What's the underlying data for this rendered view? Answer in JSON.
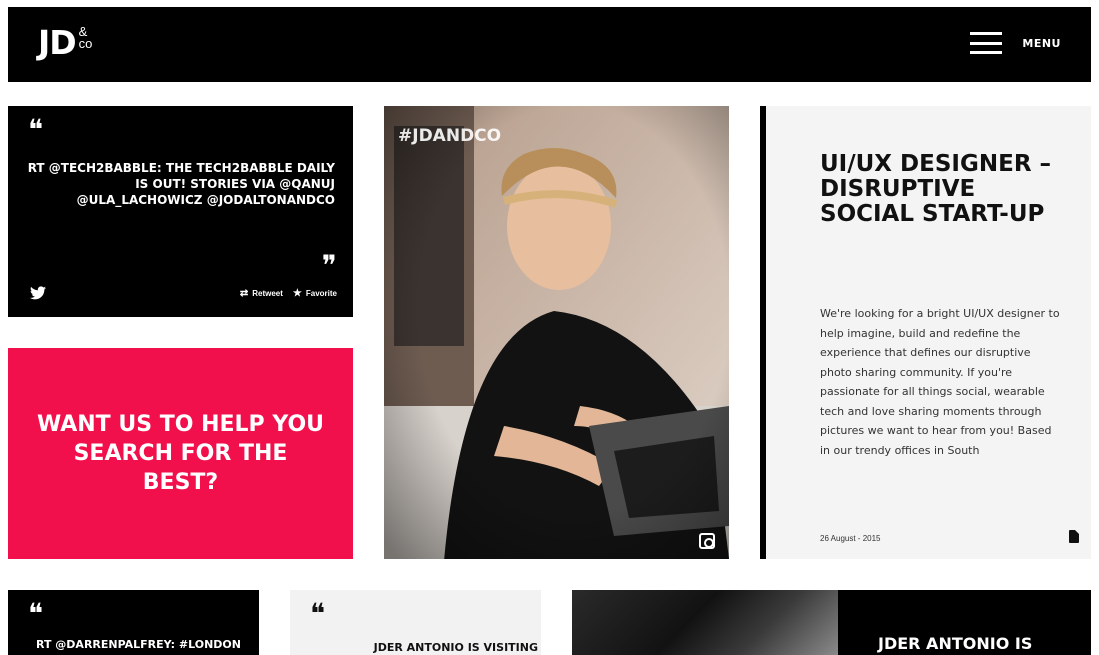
{
  "header": {
    "logo_main": "JD",
    "logo_amp": "&",
    "logo_co": "co",
    "menu_label": "MENU"
  },
  "tiles": {
    "tweet1": {
      "text": "RT @TECH2BABBLE: THE TECH2BABBLE DAILY IS OUT! STORIES VIA @QANUJ @ULA_LACHOWICZ @JODALTONANDCO",
      "retweet_label": "Retweet",
      "favorite_label": "Favorite"
    },
    "cta": {
      "text": "WANT US TO HELP YOU SEARCH FOR THE BEST?"
    },
    "photo": {
      "tag": "#JDANDCO"
    },
    "job": {
      "title": "UI/UX DESIGNER – DISRUPTIVE SOCIAL START-UP",
      "description": "We're looking for a bright UI/UX designer to help imagine, build and redefine the experience that defines our disruptive photo sharing community. If you're passionate for all things social, wearable tech and love sharing moments through pictures we want to hear from you! Based in our trendy offices in South",
      "date": "26 August - 2015"
    },
    "tweet2": {
      "text": "RT @DARRENPALFREY: #LONDON #KENSINGTON"
    },
    "tweet3": {
      "text": "JDER ANTONIO IS VISITING"
    },
    "feature": {
      "title": "JDER ANTONIO IS"
    }
  },
  "icons": {
    "menu": "hamburger-icon",
    "twitter": "twitter-bird-icon",
    "retweet": "retweet-icon",
    "favorite": "star-icon",
    "instagram": "instagram-icon",
    "document": "document-icon"
  },
  "colors": {
    "header_bg": "#000000",
    "cta_bg": "#f2104c",
    "job_bg": "#f4f4f4"
  }
}
